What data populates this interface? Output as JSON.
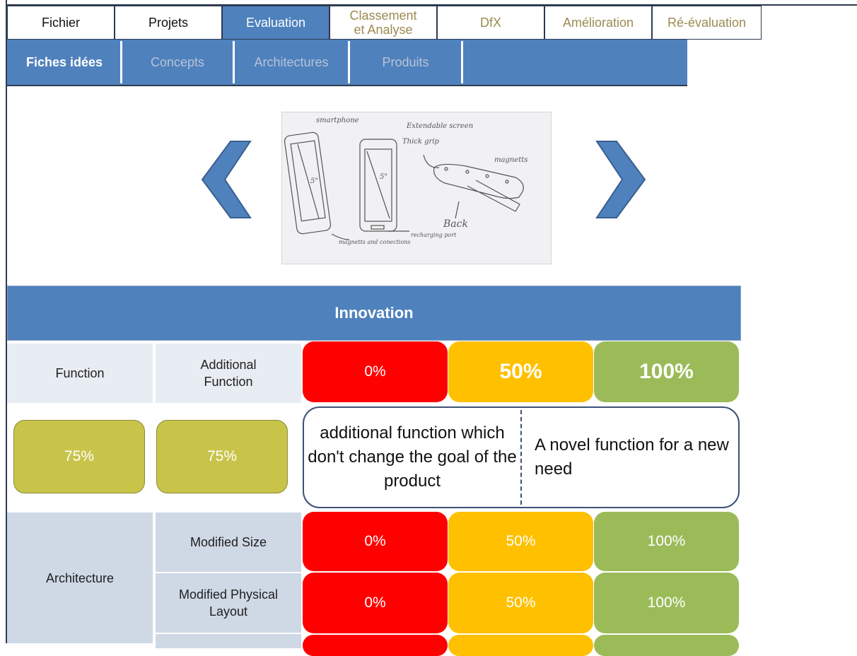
{
  "menu": {
    "tabs": [
      {
        "label": "Fichier",
        "state": "normal"
      },
      {
        "label": "Projets",
        "state": "normal"
      },
      {
        "label": "Evaluation",
        "state": "active"
      },
      {
        "label": "Classement et Analyse",
        "state": "muted"
      },
      {
        "label": "DfX",
        "state": "muted"
      },
      {
        "label": "Amélioration",
        "state": "muted"
      },
      {
        "label": "Ré-évaluation",
        "state": "muted"
      }
    ]
  },
  "submenu": {
    "tabs": [
      {
        "label": "Fiches idées",
        "state": "active"
      },
      {
        "label": "Concepts",
        "state": "muted"
      },
      {
        "label": "Architectures",
        "state": "muted"
      },
      {
        "label": "Produits",
        "state": "muted"
      }
    ]
  },
  "carousel": {
    "prev_icon": "chevron-left-icon",
    "next_icon": "chevron-right-icon",
    "sketch_labels": [
      "smartphone",
      "Extendable screen",
      "Thick grip",
      "magnetts",
      "5\"",
      "5\"",
      "Back",
      "magnetts and conections",
      "recharging port"
    ]
  },
  "innovation": {
    "title": "Innovation",
    "function": {
      "label": "Function",
      "sub_label": "Additional Function",
      "scale": [
        "0%",
        "50%",
        "100%"
      ],
      "score_function": "75%",
      "score_additional": "75%",
      "desc_low": "additional function which don't change the goal of the product",
      "desc_high": "A novel function for a new need"
    },
    "architecture": {
      "label": "Architecture",
      "rows": [
        {
          "label": "Modified Size",
          "scale": [
            "0%",
            "50%",
            "100%"
          ]
        },
        {
          "label": "Modified Physical Layout",
          "scale": [
            "0%",
            "50%",
            "100%"
          ]
        }
      ]
    }
  },
  "colors": {
    "accent": "#4f81bd",
    "low": "#ff0000",
    "mid": "#ffc000",
    "high": "#9bbb59",
    "score": "#c8c44a"
  }
}
